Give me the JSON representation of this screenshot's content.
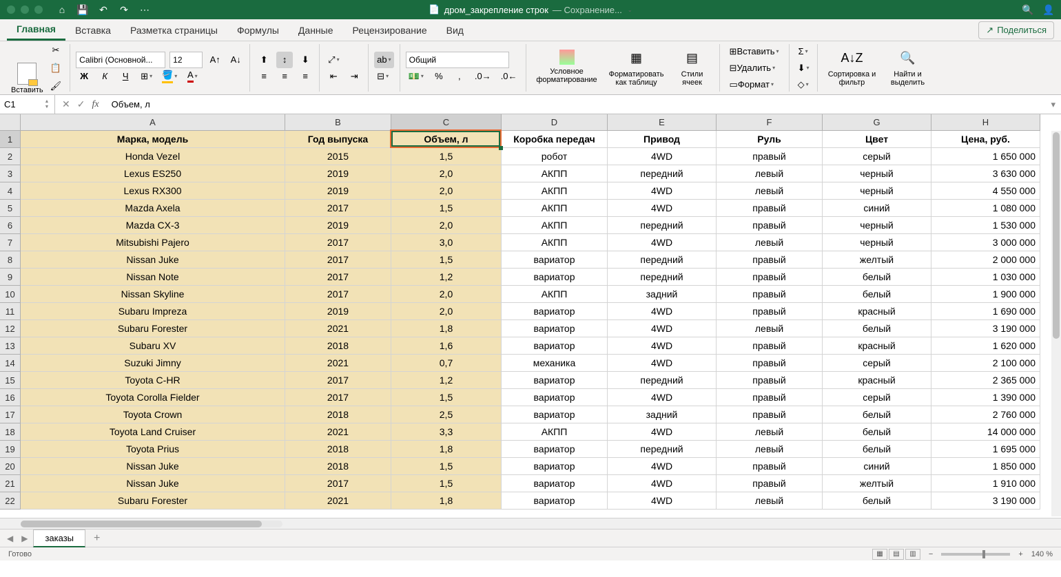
{
  "title": {
    "filename": "дром_закрепление строк",
    "status": "— Сохранение..."
  },
  "tabs": {
    "home": "Главная",
    "insert": "Вставка",
    "layout": "Разметка страницы",
    "formulas": "Формулы",
    "data": "Данные",
    "review": "Рецензирование",
    "view": "Вид"
  },
  "share": "Поделиться",
  "ribbon": {
    "paste": "Вставить",
    "font_name": "Calibri (Основной...",
    "font_size": "12",
    "number_format": "Общий",
    "conditional": "Условное форматирование",
    "format_table": "Форматировать как таблицу",
    "cell_styles": "Стили ячеек",
    "insert": "Вставить",
    "delete": "Удалить",
    "format": "Формат",
    "sort_filter": "Сортировка и фильтр",
    "find_select": "Найти и выделить"
  },
  "formula_bar": {
    "name_box": "C1",
    "formula": "Объем, л"
  },
  "columns": [
    "A",
    "B",
    "C",
    "D",
    "E",
    "F",
    "G",
    "H"
  ],
  "headers": [
    "Марка, модель",
    "Год выпуска",
    "Объем, л",
    "Коробка передач",
    "Привод",
    "Руль",
    "Цвет",
    "Цена, руб."
  ],
  "rows": [
    [
      "Honda Vezel",
      "2015",
      "1,5",
      "робот",
      "4WD",
      "правый",
      "серый",
      "1 650 000"
    ],
    [
      "Lexus ES250",
      "2019",
      "2,0",
      "АКПП",
      "передний",
      "левый",
      "черный",
      "3 630 000"
    ],
    [
      "Lexus RX300",
      "2019",
      "2,0",
      "АКПП",
      "4WD",
      "левый",
      "черный",
      "4 550 000"
    ],
    [
      "Mazda Axela",
      "2017",
      "1,5",
      "АКПП",
      "4WD",
      "правый",
      "синий",
      "1 080 000"
    ],
    [
      "Mazda CX-3",
      "2019",
      "2,0",
      "АКПП",
      "передний",
      "правый",
      "черный",
      "1 530 000"
    ],
    [
      "Mitsubishi Pajero",
      "2017",
      "3,0",
      "АКПП",
      "4WD",
      "левый",
      "черный",
      "3 000 000"
    ],
    [
      "Nissan Juke",
      "2017",
      "1,5",
      "вариатор",
      "передний",
      "правый",
      "желтый",
      "2 000 000"
    ],
    [
      "Nissan Note",
      "2017",
      "1,2",
      "вариатор",
      "передний",
      "правый",
      "белый",
      "1 030 000"
    ],
    [
      "Nissan Skyline",
      "2017",
      "2,0",
      "АКПП",
      "задний",
      "правый",
      "белый",
      "1 900 000"
    ],
    [
      "Subaru Impreza",
      "2019",
      "2,0",
      "вариатор",
      "4WD",
      "правый",
      "красный",
      "1 690 000"
    ],
    [
      "Subaru Forester",
      "2021",
      "1,8",
      "вариатор",
      "4WD",
      "левый",
      "белый",
      "3 190 000"
    ],
    [
      "Subaru XV",
      "2018",
      "1,6",
      "вариатор",
      "4WD",
      "правый",
      "красный",
      "1 620 000"
    ],
    [
      "Suzuki Jimny",
      "2021",
      "0,7",
      "механика",
      "4WD",
      "правый",
      "серый",
      "2 100 000"
    ],
    [
      "Toyota C-HR",
      "2017",
      "1,2",
      "вариатор",
      "передний",
      "правый",
      "красный",
      "2 365 000"
    ],
    [
      "Toyota Corolla Fielder",
      "2017",
      "1,5",
      "вариатор",
      "4WD",
      "правый",
      "серый",
      "1 390 000"
    ],
    [
      "Toyota Crown",
      "2018",
      "2,5",
      "вариатор",
      "задний",
      "правый",
      "белый",
      "2 760 000"
    ],
    [
      "Toyota Land Cruiser",
      "2021",
      "3,3",
      "АКПП",
      "4WD",
      "левый",
      "белый",
      "14 000 000"
    ],
    [
      "Toyota Prius",
      "2018",
      "1,8",
      "вариатор",
      "передний",
      "левый",
      "белый",
      "1 695 000"
    ],
    [
      "Nissan Juke",
      "2018",
      "1,5",
      "вариатор",
      "4WD",
      "правый",
      "синий",
      "1 850 000"
    ],
    [
      "Nissan Juke",
      "2017",
      "1,5",
      "вариатор",
      "4WD",
      "правый",
      "желтый",
      "1 910 000"
    ],
    [
      "Subaru Forester",
      "2021",
      "1,8",
      "вариатор",
      "4WD",
      "левый",
      "белый",
      "3 190 000"
    ]
  ],
  "sheet": {
    "name": "заказы"
  },
  "status": {
    "ready": "Готово",
    "zoom": "140 %"
  },
  "selected_cell": {
    "row": 0,
    "col": 2
  }
}
